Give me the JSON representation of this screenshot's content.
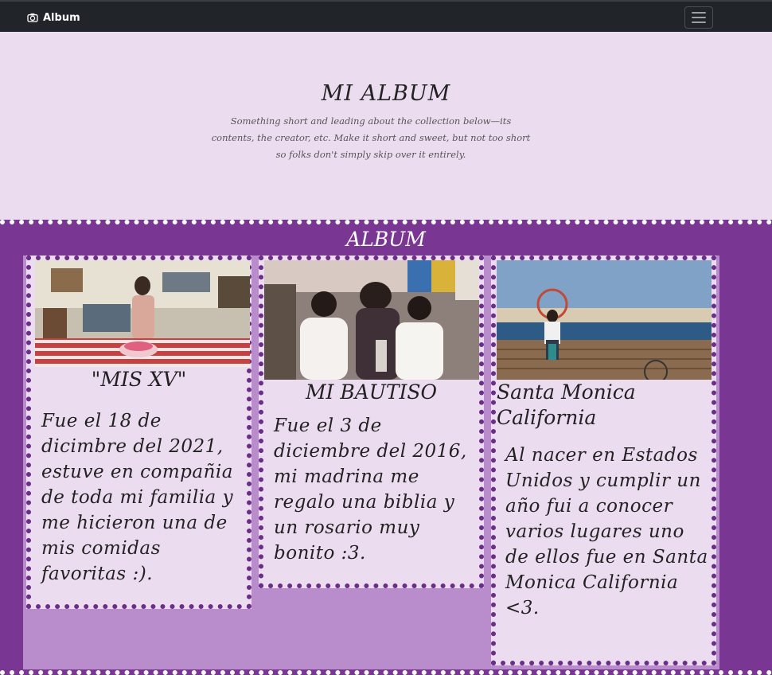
{
  "navbar": {
    "brand": "Album",
    "brand_icon": "camera-icon",
    "toggler_icon": "hamburger-menu-icon"
  },
  "hero": {
    "title": "MI ALBUM",
    "lead": "Something short and leading about the collection below—its contents, the creator, etc. Make it short and sweet, but not too short so folks don't simply skip over it entirely."
  },
  "album": {
    "heading": "ALBUM",
    "cards": [
      {
        "title": "\"MIS XV\"",
        "text": "Fue el 18 de dicimbre del 2021, estuve en compañia de toda mi familia y me hicieron una de mis comidas favoritas :).",
        "photo": "birthday-party-photo"
      },
      {
        "title": "MI BAUTISO",
        "text": "Fue el 3 de diciembre del 2016, mi madrina me regalo una biblia y un rosario muy bonito :3.",
        "photo": "baptism-photo"
      },
      {
        "title": "Santa Monica California",
        "text": "Al nacer en Estados Unidos y cumplir un año fui a conocer varios lugares uno de ellos fue en Santa Monica California <3.",
        "photo": "santa-monica-pier-photo"
      }
    ]
  },
  "colors": {
    "navbar": "#212529",
    "page_background": "#ecdcf0",
    "album_background": "#7a3693",
    "grid_background": "#b98ccc",
    "card_border": "#6a2d88"
  }
}
